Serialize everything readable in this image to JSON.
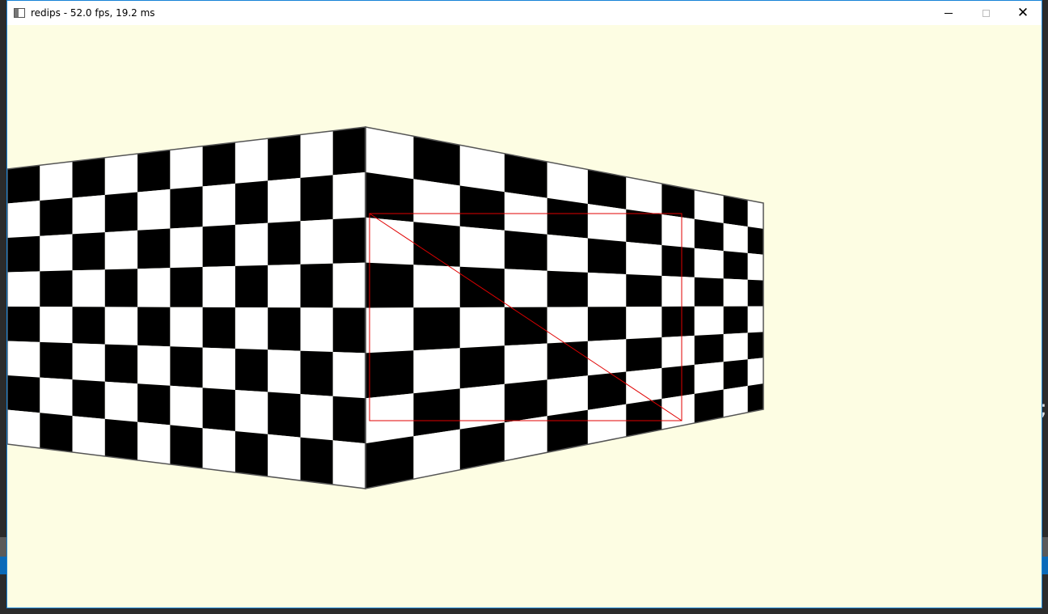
{
  "window": {
    "title": "redips - 52.0 fps, 19.2 ms",
    "controls": {
      "minimize": "minimize",
      "maximize": "maximize",
      "close": "✕"
    }
  },
  "desktop": {
    "edge_glyph": ";"
  },
  "scene": {
    "background_color": "#fdfde3",
    "checker_dark": "#000000",
    "checker_light": "#ffffff",
    "overlay_color": "#e00000",
    "left_wall": {
      "columns": 11,
      "rows": 8
    },
    "right_wall": {
      "columns": 11,
      "rows": 8
    },
    "overlay": {
      "shape": "rectangle with diagonal"
    }
  }
}
